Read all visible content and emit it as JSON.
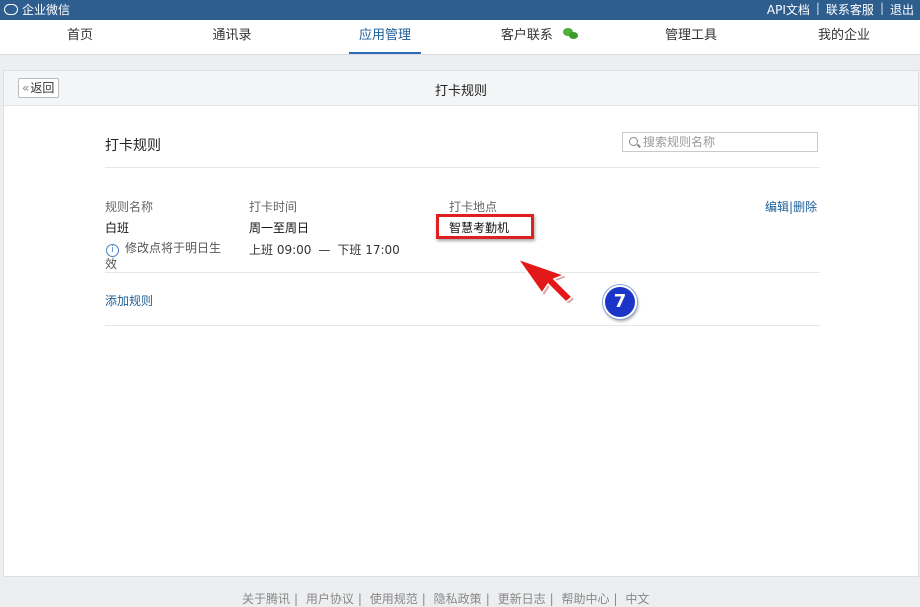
{
  "topbar": {
    "logo_text": "企业微信",
    "links": [
      {
        "label": "API文档"
      },
      {
        "label": "联系客服"
      },
      {
        "label": "退出"
      }
    ],
    "separator": "|"
  },
  "nav": {
    "items": [
      {
        "label": "首页",
        "active": false
      },
      {
        "label": "通讯录",
        "active": false
      },
      {
        "label": "应用管理",
        "active": true
      },
      {
        "label": "客户联系",
        "active": false,
        "icon": "wechat-icon"
      },
      {
        "label": "管理工具",
        "active": false
      },
      {
        "label": "我的企业",
        "active": false
      }
    ]
  },
  "panel": {
    "back_chevron": "«",
    "back_label": "返回",
    "title": "打卡规则",
    "section_title": "打卡规则",
    "search_placeholder": "搜索规则名称"
  },
  "rule": {
    "headers": {
      "name": "规则名称",
      "time": "打卡时间",
      "place": "打卡地点"
    },
    "name": "白班",
    "note": "修改点将于明日生效",
    "days": "周一至周日",
    "on_duty": "上班 09:00",
    "dash": "—",
    "off_duty": "下班 17:00",
    "place": "智慧考勤机",
    "edit_label": "编辑",
    "action_separator": "|",
    "delete_label": "删除"
  },
  "add_rule_label": "添加规则",
  "annotation": {
    "step_number": "7",
    "highlight_color": "#e02020",
    "badge_color": "#1a35c8"
  },
  "footer": {
    "links": [
      "关于腾讯",
      "用户协议",
      "使用规范",
      "隐私政策",
      "更新日志",
      "帮助中心",
      "中文"
    ],
    "separator": "|"
  },
  "colors": {
    "topbar": "#2e5e8e",
    "link": "#1d5f97",
    "active_tab": "#2b6cb5"
  }
}
